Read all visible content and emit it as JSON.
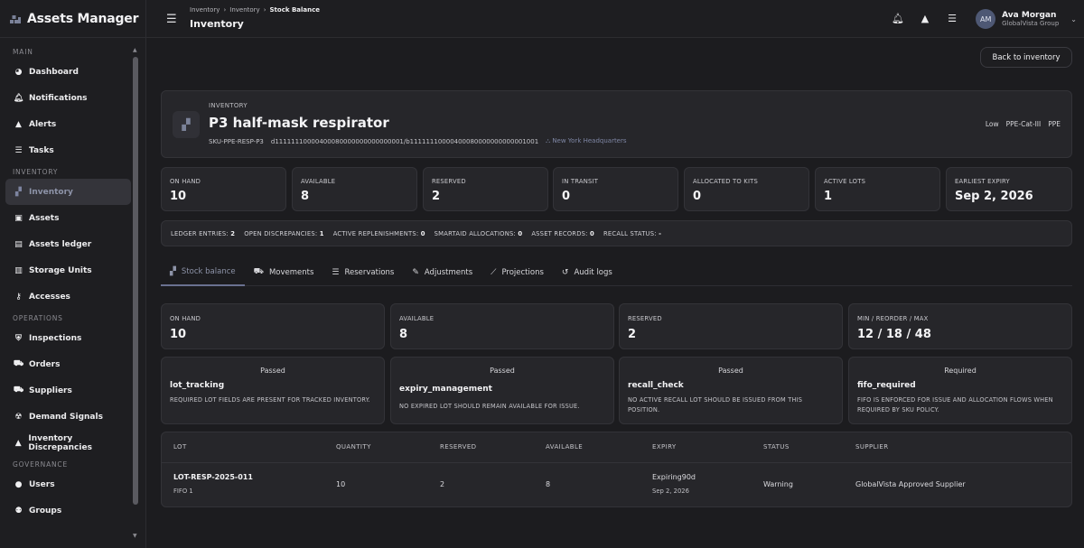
{
  "app": {
    "title": "Assets Manager"
  },
  "sidebar": {
    "sections": [
      {
        "label": "MAIN",
        "items": [
          {
            "label": "Dashboard",
            "icon": "dashboard-icon"
          },
          {
            "label": "Notifications",
            "icon": "bell-icon"
          },
          {
            "label": "Alerts",
            "icon": "alert-icon"
          },
          {
            "label": "Tasks",
            "icon": "tasks-icon"
          }
        ]
      },
      {
        "label": "INVENTORY",
        "items": [
          {
            "label": "Inventory",
            "icon": "inventory-icon",
            "active": true
          },
          {
            "label": "Assets",
            "icon": "assets-icon"
          },
          {
            "label": "Assets ledger",
            "icon": "ledger-icon"
          },
          {
            "label": "Storage Units",
            "icon": "storage-icon"
          },
          {
            "label": "Accesses",
            "icon": "key-icon"
          }
        ]
      },
      {
        "label": "OPERATIONS",
        "items": [
          {
            "label": "Inspections",
            "icon": "shield-icon"
          },
          {
            "label": "Orders",
            "icon": "truck-icon"
          },
          {
            "label": "Suppliers",
            "icon": "supplier-icon"
          },
          {
            "label": "Demand Signals",
            "icon": "signal-icon"
          },
          {
            "label": "Inventory Discrepancies",
            "icon": "alert-icon"
          }
        ]
      },
      {
        "label": "GOVERNANCE",
        "items": [
          {
            "label": "Users",
            "icon": "user-icon"
          },
          {
            "label": "Groups",
            "icon": "group-icon"
          }
        ]
      }
    ]
  },
  "topbar": {
    "breadcrumbs": [
      "Inventory",
      "Inventory",
      "Stock Balance"
    ],
    "title": "Inventory",
    "user": {
      "initials": "AM",
      "name": "Ava Morgan",
      "org": "GlobalVista Group"
    }
  },
  "actions": {
    "back": "Back to inventory"
  },
  "item": {
    "section_label": "INVENTORY",
    "name": "P3 half-mask respirator",
    "sku": "SKU-PPE-RESP-P3",
    "path": "d11111110000400080000000000000001/b11111110000400080000000000001001",
    "location": "New York Headquarters",
    "tags": [
      "Low",
      "PPE-Cat-III",
      "PPE"
    ]
  },
  "kpis": [
    {
      "label": "ON HAND",
      "value": "10"
    },
    {
      "label": "AVAILABLE",
      "value": "8"
    },
    {
      "label": "RESERVED",
      "value": "2"
    },
    {
      "label": "IN TRANSIT",
      "value": "0"
    },
    {
      "label": "ALLOCATED TO KITS",
      "value": "0"
    },
    {
      "label": "ACTIVE LOTS",
      "value": "1"
    },
    {
      "label": "EARLIEST EXPIRY",
      "value": "Sep 2, 2026"
    }
  ],
  "stats": [
    {
      "label": "LEDGER ENTRIES:",
      "value": "2"
    },
    {
      "label": "OPEN DISCREPANCIES:",
      "value": "1"
    },
    {
      "label": "ACTIVE REPLENISHMENTS:",
      "value": "0"
    },
    {
      "label": "SMARTAID ALLOCATIONS:",
      "value": "0"
    },
    {
      "label": "ASSET RECORDS:",
      "value": "0"
    },
    {
      "label": "RECALL STATUS:",
      "value": "-"
    }
  ],
  "tabs": [
    {
      "label": "Stock balance",
      "icon": "stock-icon",
      "active": true
    },
    {
      "label": "Movements",
      "icon": "truck-icon"
    },
    {
      "label": "Reservations",
      "icon": "list-icon"
    },
    {
      "label": "Adjustments",
      "icon": "edit-icon"
    },
    {
      "label": "Projections",
      "icon": "chart-icon"
    },
    {
      "label": "Audit logs",
      "icon": "history-icon"
    }
  ],
  "balance": [
    {
      "label": "ON HAND",
      "value": "10"
    },
    {
      "label": "AVAILABLE",
      "value": "8"
    },
    {
      "label": "RESERVED",
      "value": "2"
    },
    {
      "label": "MIN / REORDER / MAX",
      "value": "12 / 18 / 48"
    }
  ],
  "rules": [
    {
      "status": "Passed",
      "name": "lot_tracking",
      "desc": "REQUIRED LOT FIELDS ARE PRESENT FOR TRACKED INVENTORY."
    },
    {
      "status": "Passed",
      "name": "expiry_management",
      "desc": "NO EXPIRED LOT SHOULD REMAIN AVAILABLE FOR ISSUE."
    },
    {
      "status": "Passed",
      "name": "recall_check",
      "desc": "NO ACTIVE RECALL LOT SHOULD BE ISSUED FROM THIS POSITION."
    },
    {
      "status": "Required",
      "name": "fifo_required",
      "desc": "FIFO IS ENFORCED FOR ISSUE AND ALLOCATION FLOWS WHEN REQUIRED BY SKU POLICY."
    }
  ],
  "lots_table": {
    "columns": [
      "LOT",
      "QUANTITY",
      "RESERVED",
      "AVAILABLE",
      "EXPIRY",
      "STATUS",
      "SUPPLIER"
    ],
    "rows": [
      {
        "lot": "LOT-RESP-2025-011",
        "fifo": "FIFO 1",
        "quantity": "10",
        "reserved": "2",
        "available": "8",
        "expiry_state": "Expiring90d",
        "expiry_date": "Sep 2, 2026",
        "status": "Warning",
        "supplier": "GlobalVista Approved Supplier"
      }
    ]
  }
}
